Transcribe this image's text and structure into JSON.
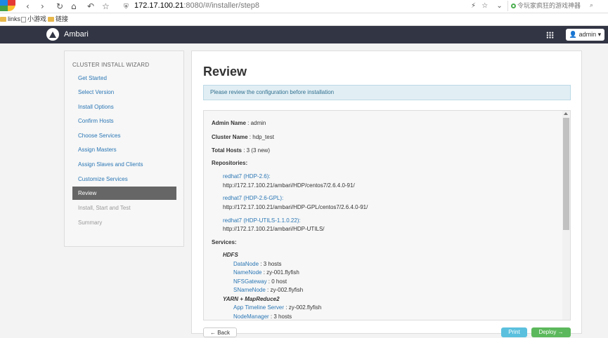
{
  "browser": {
    "url_host": "172.17.100.21",
    "url_path": ":8080/#/installer/step8",
    "search_placeholder": "令玩家疯狂的游戏神器"
  },
  "bookmarks": [
    {
      "label": "links"
    },
    {
      "label": "小游戏"
    },
    {
      "label": "链接"
    }
  ],
  "header": {
    "brand": "Ambari",
    "user_label": "admin"
  },
  "sidebar": {
    "title": "CLUSTER INSTALL WIZARD",
    "items": [
      {
        "label": "Get Started",
        "state": "link"
      },
      {
        "label": "Select Version",
        "state": "link"
      },
      {
        "label": "Install Options",
        "state": "link"
      },
      {
        "label": "Confirm Hosts",
        "state": "link"
      },
      {
        "label": "Choose Services",
        "state": "link"
      },
      {
        "label": "Assign Masters",
        "state": "link"
      },
      {
        "label": "Assign Slaves and Clients",
        "state": "link"
      },
      {
        "label": "Customize Services",
        "state": "link"
      },
      {
        "label": "Review",
        "state": "active"
      },
      {
        "label": "Install, Start and Test",
        "state": "disabled"
      },
      {
        "label": "Summary",
        "state": "disabled"
      }
    ]
  },
  "main": {
    "title": "Review",
    "alert": "Please review the configuration before installation",
    "admin_name_label": "Admin Name",
    "admin_name_value": " : admin",
    "cluster_name_label": "Cluster Name",
    "cluster_name_value": " : hdp_test",
    "total_hosts_label": "Total Hosts",
    "total_hosts_value": " : 3 (3 new)",
    "repositories_label": "Repositories:",
    "repositories": [
      {
        "name": "redhat7 (HDP-2.6):",
        "url": "http://172.17.100.21/ambari/HDP/centos7/2.6.4.0-91/"
      },
      {
        "name": "redhat7 (HDP-2.6-GPL):",
        "url": "http://172.17.100.21/ambari/HDP-GPL/centos7/2.6.4.0-91/"
      },
      {
        "name": "redhat7 (HDP-UTILS-1.1.0.22):",
        "url": "http://172.17.100.21/ambari/HDP-UTILS/"
      }
    ],
    "services_label": "Services:",
    "services": [
      {
        "group": "HDFS",
        "components": [
          {
            "name": "DataNode",
            "value": " : 3 hosts"
          },
          {
            "name": "NameNode",
            "value": " : zy-001.flyfish"
          },
          {
            "name": "NFSGateway",
            "value": " : 0 host"
          },
          {
            "name": "SNameNode",
            "value": " : zy-002.flyfish"
          }
        ]
      },
      {
        "group": "YARN + MapReduce2",
        "components": [
          {
            "name": "App Timeline Server",
            "value": " : zy-002.flyfish"
          },
          {
            "name": "NodeManager",
            "value": " : 3 hosts"
          }
        ]
      }
    ],
    "buttons": {
      "back": "← Back",
      "print": "Print",
      "deploy": "Deploy →"
    }
  }
}
